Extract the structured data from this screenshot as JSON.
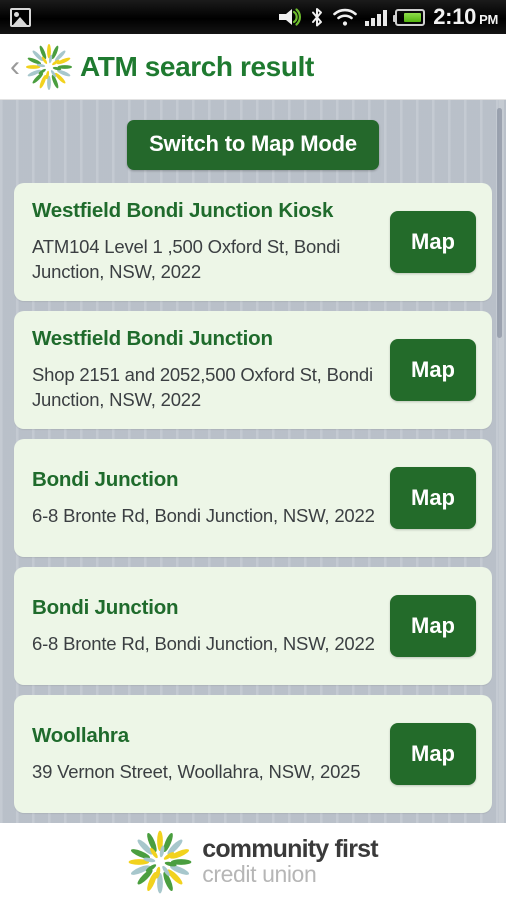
{
  "status_bar": {
    "photo_icon": "photo-icon",
    "ringer_icon": "ringer-sound-icon",
    "bluetooth_icon": "bluetooth-icon",
    "wifi_icon": "wifi-icon",
    "signal_icon": "cellular-signal-icon",
    "battery_icon": "battery-icon",
    "time": "2:10",
    "am_pm": "PM"
  },
  "header": {
    "back_icon": "back-chevron-icon",
    "logo_icon": "community-first-starburst-icon",
    "title": "ATM search result"
  },
  "toolbar": {
    "switch_mode_label": "Switch to Map Mode"
  },
  "results": [
    {
      "title": "Westfield Bondi Junction Kiosk",
      "address": "ATM104 Level 1 ,500 Oxford St, Bondi Junction, NSW, 2022",
      "map_label": "Map"
    },
    {
      "title": "Westfield Bondi Junction",
      "address": "Shop 2151 and 2052,500 Oxford St, Bondi Junction, NSW, 2022",
      "map_label": "Map"
    },
    {
      "title": "Bondi Junction",
      "address": "6-8 Bronte Rd, Bondi Junction, NSW, 2022",
      "map_label": "Map"
    },
    {
      "title": "Bondi Junction",
      "address": "6-8 Bronte Rd, Bondi Junction, NSW, 2022",
      "map_label": "Map"
    },
    {
      "title": "Woollahra",
      "address": "39 Vernon Street, Woollahra, NSW, 2025",
      "map_label": "Map"
    }
  ],
  "footer": {
    "logo_icon": "community-first-starburst-icon",
    "brand_line1": "community first",
    "brand_line2": "credit union"
  },
  "colors": {
    "brand_green": "#1f7a30",
    "button_green": "#236b2a",
    "card_bg": "#edf6e7",
    "page_bg": "#bdc4cd",
    "petal_green": "#4a9e3f",
    "petal_yellow": "#f2d21e",
    "petal_blue": "#a7c7cc"
  }
}
